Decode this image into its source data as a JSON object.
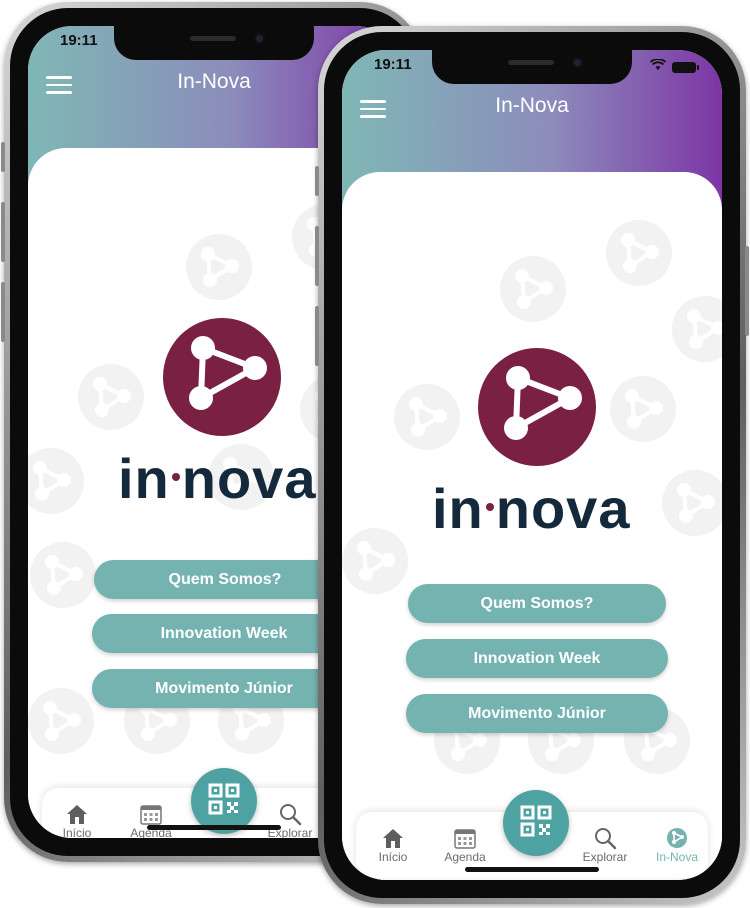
{
  "status_bar": {
    "time": "19:11"
  },
  "header": {
    "title": "In-Nova",
    "menu_icon": "hamburger-menu-icon"
  },
  "logo": {
    "prefix": "in",
    "suffix": "nova",
    "brand_color": "#7a2043",
    "text_color": "#142a3c"
  },
  "buttons": [
    {
      "label": "Quem Somos?"
    },
    {
      "label": "Innovation Week"
    },
    {
      "label": "Movimento Júnior"
    }
  ],
  "tabbar": {
    "tabs": [
      {
        "label": "Início",
        "icon": "home-icon"
      },
      {
        "label": "Agenda",
        "icon": "calendar-icon"
      },
      {
        "label": "Explorar",
        "icon": "search-icon"
      },
      {
        "label": "In-Nova",
        "icon": "in-nova-icon"
      }
    ],
    "fab_icon": "qr-code-icon"
  },
  "colors": {
    "accent": "#75b3b1",
    "fab": "#4ea3a2",
    "header_gradient": [
      "#7fb7b5",
      "#8c8cbb",
      "#7d35a5"
    ]
  }
}
